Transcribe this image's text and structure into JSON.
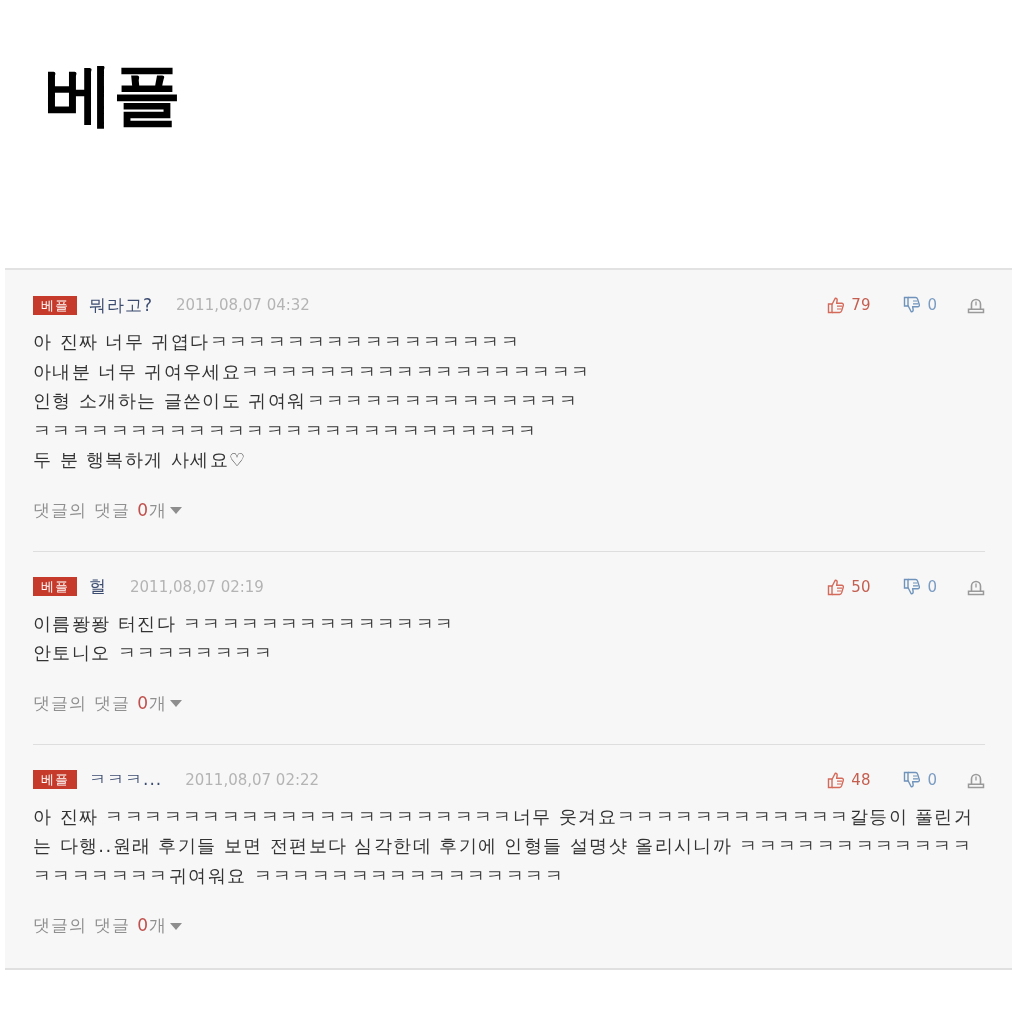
{
  "title": "베플",
  "comments": [
    {
      "badge": "베플",
      "nickname": "뭐라고?",
      "date": "2011,08,07 04:32",
      "likes": "79",
      "dislikes": "0",
      "body": [
        "아 진짜 너무 귀엽다ㅋㅋㅋㅋㅋㅋㅋㅋㅋㅋㅋㅋㅋㅋㅋㅋ",
        "아내분 너무 귀여우세요ㅋㅋㅋㅋㅋㅋㅋㅋㅋㅋㅋㅋㅋㅋㅋㅋㅋㅋ",
        "인형 소개하는 글쓴이도 귀여워ㅋㅋㅋㅋㅋㅋㅋㅋㅋㅋㅋㅋㅋㅋ",
        "ㅋㅋㅋㅋㅋㅋㅋㅋㅋㅋㅋㅋㅋㅋㅋㅋㅋㅋㅋㅋㅋㅋㅋㅋㅋㅋ",
        "두 분 행복하게 사세요♡"
      ],
      "replies": {
        "label": "댓글의 댓글",
        "count": "0",
        "unit": "개"
      }
    },
    {
      "badge": "베플",
      "nickname": "헐",
      "date": "2011,08,07 02:19",
      "likes": "50",
      "dislikes": "0",
      "body": [
        "이름퐝퐝 터진다 ㅋㅋㅋㅋㅋㅋㅋㅋㅋㅋㅋㅋㅋㅋ",
        "안토니오 ㅋㅋㅋㅋㅋㅋㅋㅋ"
      ],
      "replies": {
        "label": "댓글의 댓글",
        "count": "0",
        "unit": "개"
      }
    },
    {
      "badge": "베플",
      "nickname": "ㅋㅋㅋ...",
      "date": "2011,08,07 02:22",
      "likes": "48",
      "dislikes": "0",
      "body": [
        "아 진짜 ㅋㅋㅋㅋㅋㅋㅋㅋㅋㅋㅋㅋㅋㅋㅋㅋㅋㅋㅋㅋㅋ너무 웃겨요ㅋㅋㅋㅋㅋㅋㅋㅋㅋㅋㅋㅋ갈등이 풀린거는 다행..원래 후기들 보면 전편보다 심각한데 후기에 인형들 설명샷 올리시니까 ㅋㅋㅋㅋㅋㅋㅋㅋㅋㅋㅋㅋㅋㅋㅋㅋㅋㅋㅋ귀여워요 ㅋㅋㅋㅋㅋㅋㅋㅋㅋㅋㅋㅋㅋㅋㅋㅋ"
      ],
      "replies": {
        "label": "댓글의 댓글",
        "count": "0",
        "unit": "개"
      }
    }
  ]
}
